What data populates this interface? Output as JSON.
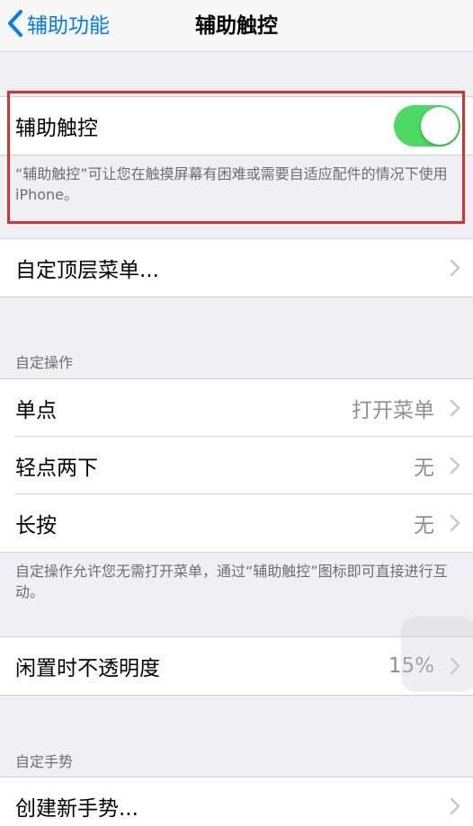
{
  "navbar": {
    "back_label": "辅助功能",
    "title": "辅助触控"
  },
  "assistive_touch": {
    "label": "辅助触控",
    "enabled": true,
    "footer": "“辅助触控”可让您在触摸屏幕有困难或需要自适应配件的情况下使用 iPhone。"
  },
  "top_menu": {
    "label": "自定顶层菜单..."
  },
  "custom_actions": {
    "header": "自定操作",
    "rows": [
      {
        "label": "单点",
        "value": "打开菜单"
      },
      {
        "label": "轻点两下",
        "value": "无"
      },
      {
        "label": "长按",
        "value": "无"
      }
    ],
    "footer": "自定操作允许您无需打开菜单，通过“辅助触控”图标即可直接进行互动。"
  },
  "idle_opacity": {
    "label": "闲置时不透明度",
    "value": "15%"
  },
  "custom_gestures": {
    "header": "自定手势",
    "create_label": "创建新手势..."
  },
  "colors": {
    "accent": "#007aff",
    "switch_on": "#4cd964",
    "highlight": "#d9312f",
    "background": "#efeff4"
  }
}
